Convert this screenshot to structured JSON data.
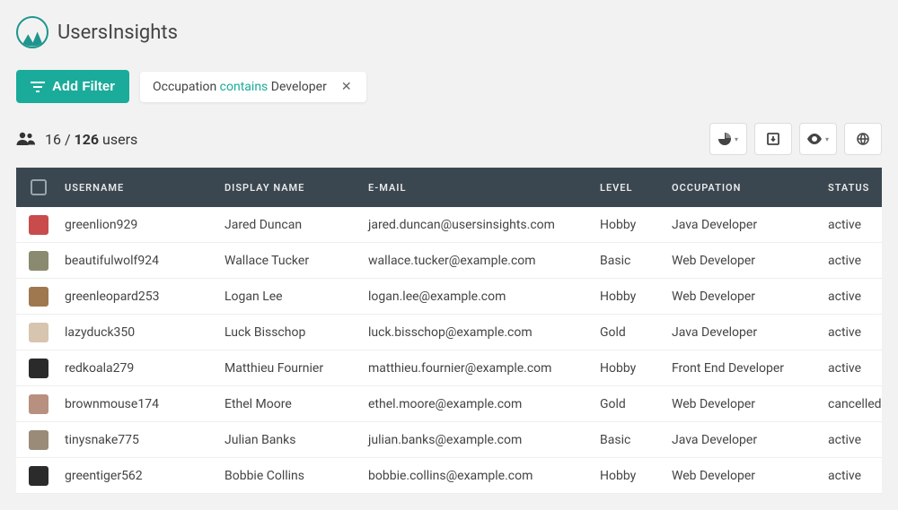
{
  "brand": {
    "name": "UsersInsights"
  },
  "filters": {
    "add_label": "Add Filter",
    "chip": {
      "field": "Occupation",
      "operator": "contains",
      "value": "Developer"
    }
  },
  "stats": {
    "filtered": "16",
    "separator": "/",
    "total": "126",
    "label": "users"
  },
  "columns": {
    "username": "USERNAME",
    "display": "DISPLAY NAME",
    "email": "E-MAIL",
    "level": "LEVEL",
    "occupation": "OCCUPATION",
    "status": "STATUS"
  },
  "rows": [
    {
      "username": "greenlion929",
      "display": "Jared Duncan",
      "email": "jared.duncan@usersinsights.com",
      "level": "Hobby",
      "occupation": "Java Developer",
      "status": "active",
      "avatar_bg": "#c94b4b"
    },
    {
      "username": "beautifulwolf924",
      "display": "Wallace Tucker",
      "email": "wallace.tucker@example.com",
      "level": "Basic",
      "occupation": "Web Developer",
      "status": "active",
      "avatar_bg": "#8a8a70"
    },
    {
      "username": "greenleopard253",
      "display": "Logan Lee",
      "email": "logan.lee@example.com",
      "level": "Hobby",
      "occupation": "Web Developer",
      "status": "active",
      "avatar_bg": "#a07850"
    },
    {
      "username": "lazyduck350",
      "display": "Luck Bisschop",
      "email": "luck.bisschop@example.com",
      "level": "Gold",
      "occupation": "Java Developer",
      "status": "active",
      "avatar_bg": "#d8c5b0"
    },
    {
      "username": "redkoala279",
      "display": "Matthieu Fournier",
      "email": "matthieu.fournier@example.com",
      "level": "Hobby",
      "occupation": "Front End Developer",
      "status": "active",
      "avatar_bg": "#2a2a2a"
    },
    {
      "username": "brownmouse174",
      "display": "Ethel Moore",
      "email": "ethel.moore@example.com",
      "level": "Gold",
      "occupation": "Web Developer",
      "status": "cancelled",
      "avatar_bg": "#b89080"
    },
    {
      "username": "tinysnake775",
      "display": "Julian Banks",
      "email": "julian.banks@example.com",
      "level": "Basic",
      "occupation": "Java Developer",
      "status": "active",
      "avatar_bg": "#9a8a78"
    },
    {
      "username": "greentiger562",
      "display": "Bobbie Collins",
      "email": "bobbie.collins@example.com",
      "level": "Hobby",
      "occupation": "Web Developer",
      "status": "active",
      "avatar_bg": "#2b2b2b"
    }
  ]
}
